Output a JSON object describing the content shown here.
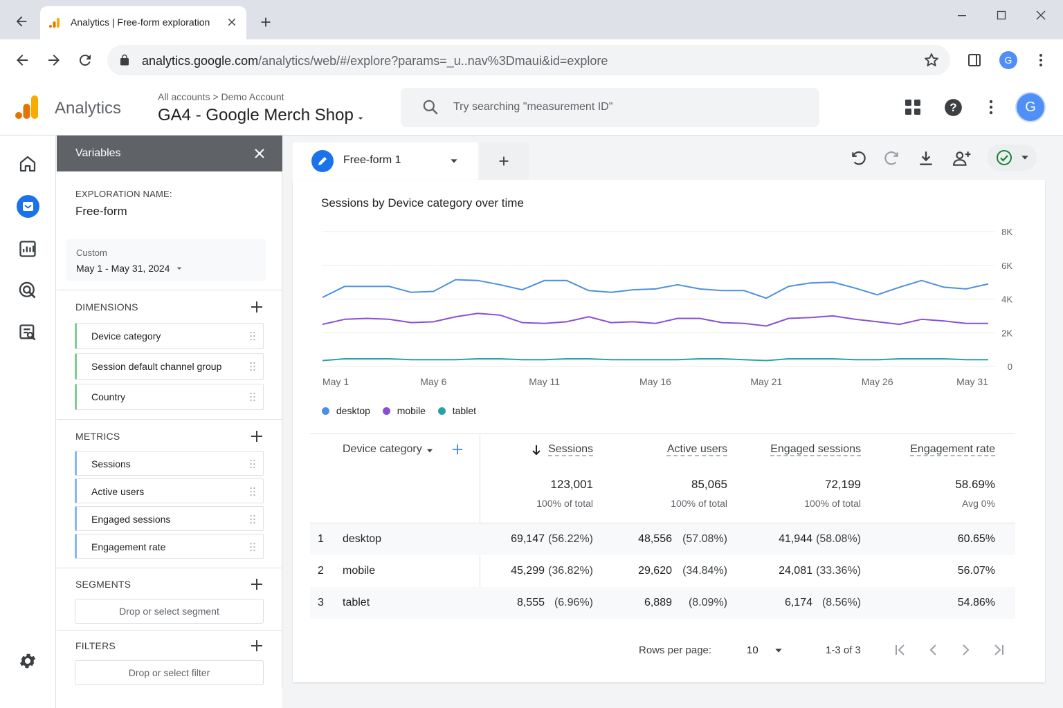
{
  "browser": {
    "tab_title": "Analytics | Free-form exploration",
    "url_host": "analytics.google.com",
    "url_path": "/analytics/web/#/explore?params=_u..nav%3Dmaui&id=explore",
    "profile_initial": "G"
  },
  "header": {
    "product_name": "Analytics",
    "breadcrumb_root": "All accounts",
    "breadcrumb_sep": ">",
    "breadcrumb_account": "Demo Account",
    "property_name": "GA4 - Google Merch Shop",
    "search_placeholder": "Try searching \"measurement ID\"",
    "avatar_initial": "G"
  },
  "variables": {
    "title": "Variables",
    "exploration_label": "EXPLORATION NAME:",
    "exploration_name": "Free-form",
    "date_label": "Custom",
    "date_range": "May 1 - May 31, 2024",
    "dimensions_title": "DIMENSIONS",
    "dimensions": [
      "Device category",
      "Session default channel group",
      "Country"
    ],
    "metrics_title": "METRICS",
    "metrics": [
      "Sessions",
      "Active users",
      "Engaged sessions",
      "Engagement rate"
    ],
    "segments_title": "SEGMENTS",
    "segment_placeholder": "Drop or select segment",
    "filters_title": "FILTERS",
    "filter_placeholder": "Drop or select filter"
  },
  "workspace": {
    "tab_name": "Free-form 1",
    "chart_title": "Sessions by Device category over time"
  },
  "chart_data": {
    "type": "line",
    "title": "Sessions by Device category over time",
    "x_labels": [
      "May 1",
      "May 6",
      "May 11",
      "May 16",
      "May 21",
      "May 26",
      "May 31"
    ],
    "x": [
      "May 1",
      "May 2",
      "May 3",
      "May 4",
      "May 5",
      "May 6",
      "May 7",
      "May 8",
      "May 9",
      "May 10",
      "May 11",
      "May 12",
      "May 13",
      "May 14",
      "May 15",
      "May 16",
      "May 17",
      "May 18",
      "May 19",
      "May 20",
      "May 21",
      "May 22",
      "May 23",
      "May 24",
      "May 25",
      "May 26",
      "May 27",
      "May 28",
      "May 29",
      "May 30",
      "May 31"
    ],
    "y_ticks": [
      "8K",
      "6K",
      "4K",
      "2K",
      "0"
    ],
    "ylim": [
      0,
      8000
    ],
    "grid": true,
    "legend_position": "bottom-left",
    "series": [
      {
        "name": "desktop",
        "color": "#4a90e2",
        "values": [
          4100,
          4750,
          4750,
          4750,
          4400,
          4450,
          5150,
          5100,
          4850,
          4550,
          5100,
          5100,
          4500,
          4400,
          4550,
          4600,
          4850,
          4600,
          4500,
          4500,
          4050,
          4750,
          4950,
          5000,
          4650,
          4250,
          4700,
          5100,
          4700,
          4600,
          4900
        ]
      },
      {
        "name": "mobile",
        "color": "#8a4fd8",
        "values": [
          2500,
          2800,
          2850,
          2800,
          2600,
          2650,
          2950,
          3150,
          3050,
          2600,
          2550,
          2650,
          2950,
          2600,
          2650,
          2550,
          2850,
          2850,
          2600,
          2550,
          2400,
          2850,
          2900,
          3000,
          2800,
          2650,
          2500,
          2800,
          2700,
          2550,
          2550
        ]
      },
      {
        "name": "tablet",
        "color": "#24a3a9",
        "values": [
          350,
          450,
          450,
          450,
          400,
          400,
          400,
          450,
          450,
          400,
          400,
          450,
          450,
          400,
          400,
          400,
          400,
          450,
          450,
          400,
          350,
          450,
          450,
          450,
          400,
          400,
          450,
          450,
          450,
          400,
          400
        ]
      }
    ]
  },
  "table": {
    "dimension_header": "Device category",
    "columns": [
      "Sessions",
      "Active users",
      "Engaged sessions",
      "Engagement rate"
    ],
    "totals": [
      {
        "value": "123,001",
        "sub": "100% of total"
      },
      {
        "value": "85,065",
        "sub": "100% of total"
      },
      {
        "value": "72,199",
        "sub": "100% of total"
      },
      {
        "value": "58.69%",
        "sub": "Avg 0%"
      }
    ],
    "rows": [
      {
        "index": "1",
        "name": "desktop",
        "cells": [
          {
            "v": "69,147",
            "p": "(56.22%)"
          },
          {
            "v": "48,556",
            "p": "(57.08%)"
          },
          {
            "v": "41,944",
            "p": "(58.08%)"
          },
          {
            "v": "60.65%",
            "p": ""
          }
        ]
      },
      {
        "index": "2",
        "name": "mobile",
        "cells": [
          {
            "v": "45,299",
            "p": "(36.82%)"
          },
          {
            "v": "29,620",
            "p": "(34.84%)"
          },
          {
            "v": "24,081",
            "p": "(33.36%)"
          },
          {
            "v": "56.07%",
            "p": ""
          }
        ]
      },
      {
        "index": "3",
        "name": "tablet",
        "cells": [
          {
            "v": "8,555",
            "p": "(6.96%)"
          },
          {
            "v": "6,889",
            "p": "(8.09%)"
          },
          {
            "v": "6,174",
            "p": "(8.56%)"
          },
          {
            "v": "54.86%",
            "p": ""
          }
        ]
      }
    ],
    "rows_per_page_label": "Rows per page:",
    "rows_per_page": "10",
    "page_range": "1-3 of 3"
  }
}
